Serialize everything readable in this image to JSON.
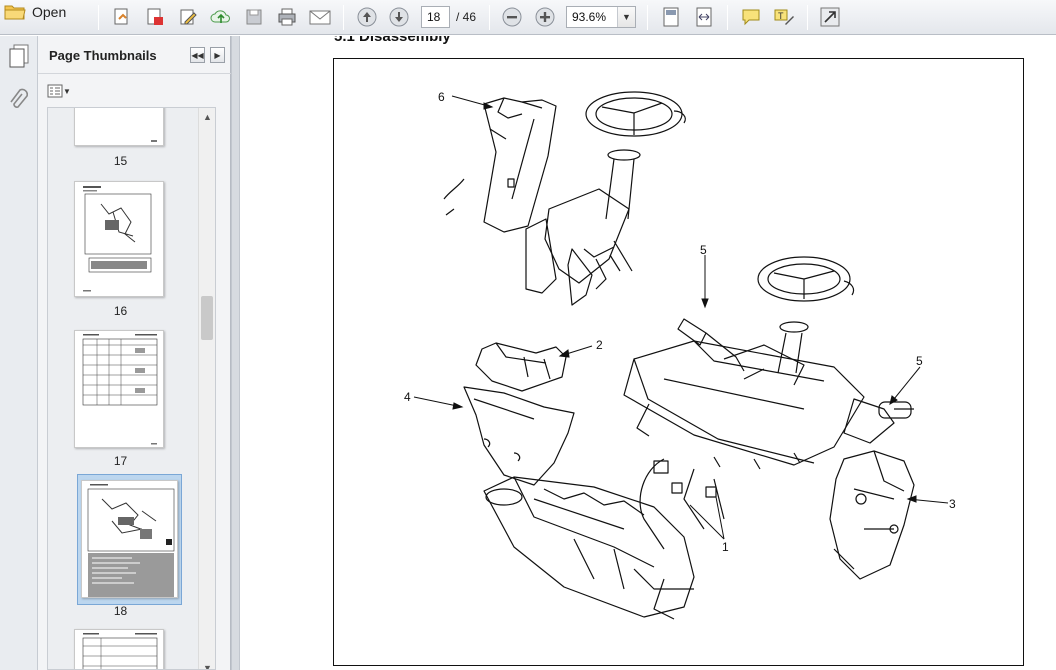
{
  "toolbar": {
    "open_label": "Open",
    "current_page": "18",
    "total_pages": "/ 46",
    "zoom": "93.6%"
  },
  "thumbnails_panel": {
    "title": "Page Thumbnails",
    "pages": [
      {
        "label": "15"
      },
      {
        "label": "16"
      },
      {
        "label": "17"
      },
      {
        "label": "18",
        "selected": true
      }
    ]
  },
  "document": {
    "section_title": "5.1  Disassembly",
    "drawing_id": "213483",
    "callouts": [
      "6",
      "5",
      "2",
      "5",
      "4",
      "3",
      "1"
    ]
  },
  "colors": {
    "selection": "#bcd6ef",
    "toolbar_bg": "#e4e7ec"
  }
}
